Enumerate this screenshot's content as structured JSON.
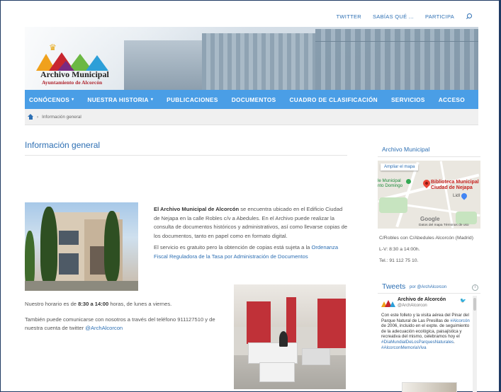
{
  "topbar": {
    "links": [
      "TWITTER",
      "SABÍAS QUÉ ...",
      "PARTICIPA"
    ]
  },
  "logo": {
    "title": "Archivo Municipal",
    "subtitle": "Ayuntamiento de Alcorcón"
  },
  "nav": {
    "items": [
      "CONÓCENOS",
      "NUESTRA HISTORIA",
      "PUBLICACIONES",
      "DOCUMENTOS",
      "CUADRO DE CLASIFICACIÓN",
      "SERVICIOS",
      "ACCESO"
    ]
  },
  "breadcrumb": {
    "separator": "›",
    "current": "Información general"
  },
  "main": {
    "title": "Información general",
    "intro_strong": "El Archivo Municipal de Alcorcón",
    "intro_rest": " se encuentra ubicado en el Edificio Ciudad de Nejapa en la calle Robles c/v a Abedules. En el Archivo puede realizar la consulta de documentos históricos y administrativos, así como llevarse copias de los documentos, tanto en papel como en formato digital.",
    "fee_text": "El servicio es gratuito pero la obtención de copias está sujeta a la ",
    "fee_link": "Ordenanza Fiscal Reguladora de la Tasa por Administración de Documentos",
    "hours_pre": "Nuestro horario es de ",
    "hours_strong": "8:30 a 14:00",
    "hours_post": " horas, de lunes a viernes.",
    "contact_text": "También puede comunicarse con nosotros a través del teléfono 911127510 y de nuestra cuenta de twitter ",
    "contact_link": "@ArchAlcorcon"
  },
  "sidebar": {
    "title": "Archivo Municipal",
    "map": {
      "enlarge": "Ampliar el mapa",
      "label_left_1": "le Municipal",
      "label_left_2": "nto Domingo",
      "place_1": "Biblioteca Municipal",
      "place_2": "Ciudad de Nejapa",
      "shop": "Lidl",
      "brand": "Google",
      "footer": "Datos del mapa   Términos de uso"
    },
    "address": "C/Robles con C/Abedules Alcorcón (Madrid)",
    "schedule": "L-V: 8:30 a 14:00h.",
    "phone": "Tel.: 91 112 75 10.",
    "tweets": {
      "title": "Tweets",
      "by": "por @ArchAlcorcon",
      "author": "Archivo de Alcorcón",
      "handle": "@ArchAlcorcon",
      "body_1": "Con este folleto y la visita aérea del Pinar del Parque Natural de Las Presillas de ",
      "tag_1": "#Alcorcón",
      "body_2": " de 2006, incluido en el expte. de seguimiento de la adecuación ecológica, paisajística y recreativa del mismo, celebramos hoy el ",
      "tag_2": "#DíaMundialDeLosParquesNaturales",
      "body_3": ". ",
      "tag_3": "#AlcorconMemoriaViva"
    }
  },
  "colors": {
    "nav": "#4a9ee6",
    "link": "#2d6fb3",
    "border": "#1f3a63"
  }
}
